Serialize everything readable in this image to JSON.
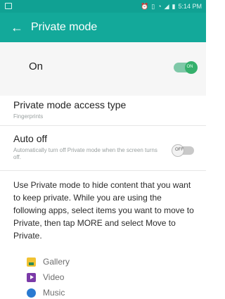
{
  "status_bar": {
    "icons": [
      "notification-icon",
      "alarm-icon",
      "vibrate-icon",
      "wifi-icon",
      "signal-icon",
      "battery-icon"
    ],
    "time": "5:14 PM"
  },
  "app_bar": {
    "title": "Private mode",
    "back_icon": "arrow-left-icon",
    "color": "#13a99a"
  },
  "master_toggle": {
    "label": "On",
    "state_text": "ON",
    "enabled": true,
    "accent": "#35b06c"
  },
  "settings": {
    "access_type": {
      "title": "Private mode access type",
      "value": "Fingerprints"
    },
    "auto_off": {
      "title": "Auto off",
      "summary": "Automatically turn off Private mode when the screen turns off.",
      "state_text": "OFF",
      "enabled": false
    }
  },
  "description": "Use Private mode to hide content that you want to keep private. While you are using the following apps, select items you want to move to Private, then tap MORE and select Move to Private.",
  "apps": [
    {
      "label": "Gallery",
      "icon": "gallery-icon"
    },
    {
      "label": "Video",
      "icon": "video-icon"
    },
    {
      "label": "Music",
      "icon": "music-icon"
    }
  ]
}
